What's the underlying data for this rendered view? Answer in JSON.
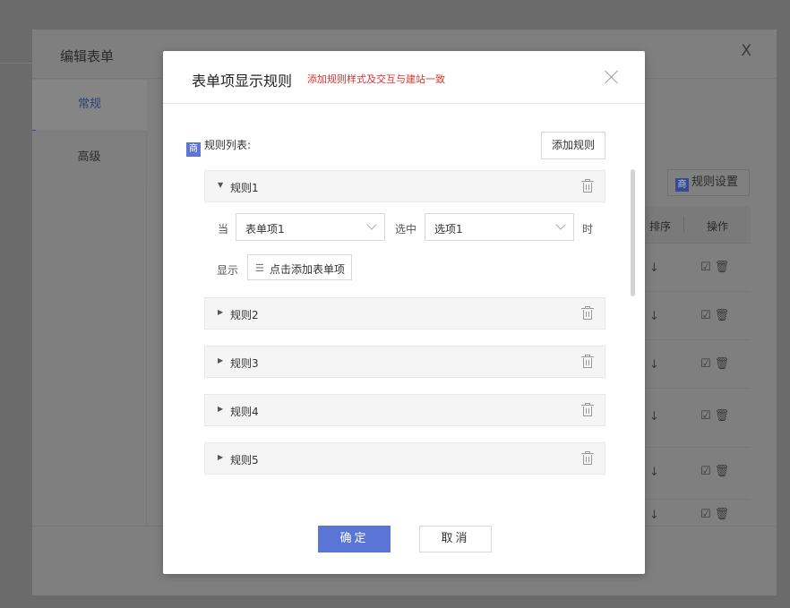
{
  "outer": {
    "title": "编辑表单",
    "close": "X",
    "tabs": [
      {
        "label": "常规"
      },
      {
        "label": "高级"
      }
    ],
    "rule_settings": {
      "icon": "商",
      "label": "规则设置"
    },
    "table": {
      "headers": [
        "排序",
        "操作"
      ],
      "row_arrow": "↓",
      "row_actions": "☑🗑"
    }
  },
  "modal": {
    "title": "表单项显示规则",
    "note": "添加规则样式及交互与建站一致",
    "list_icon": "商",
    "list_label": "规则列表:",
    "add_rule": "添加规则",
    "rules": [
      {
        "name": "规则1",
        "expanded": true
      },
      {
        "name": "规则2"
      },
      {
        "name": "规则3"
      },
      {
        "name": "规则4"
      },
      {
        "name": "规则5"
      }
    ],
    "condition": {
      "when": "当",
      "field_value": "表单项1",
      "selected": "选中",
      "option_value": "选项1",
      "time": "时"
    },
    "display": {
      "label": "显示",
      "add_field": "点击添加表单项",
      "list_icon": "☰"
    },
    "ok": "确定",
    "cancel": "取消"
  }
}
